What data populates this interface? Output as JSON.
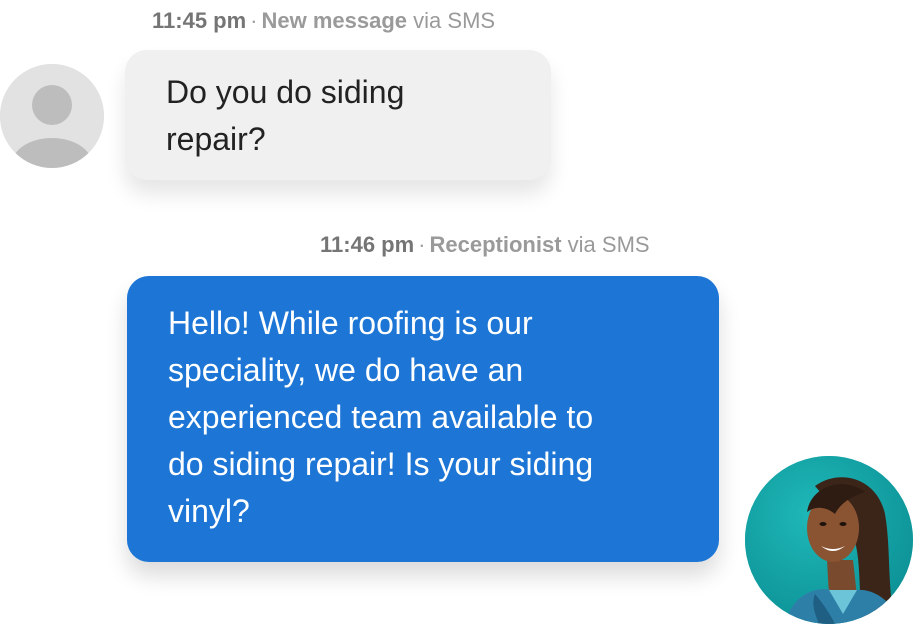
{
  "conversation": {
    "messages": [
      {
        "time": "11:45 pm",
        "separator": "·",
        "sender": "New message",
        "channel": "via SMS",
        "text": "Do you do siding\nrepair?"
      },
      {
        "time": "11:46 pm",
        "separator": "·",
        "sender": "Receptionist",
        "channel": "via SMS",
        "text": "Hello! While roofing is our\nspeciality, we do have an\nexperienced team available to\ndo siding repair! Is your siding\nvinyl?"
      }
    ]
  },
  "colors": {
    "outgoing_bubble": "#1d76d6",
    "incoming_bubble": "#f0f0f0",
    "meta_text": "#8e8e8e",
    "photo_background": "#15a3a6"
  },
  "icons": {
    "incoming_avatar": "person-placeholder-icon",
    "receptionist_avatar": "receptionist-photo"
  }
}
